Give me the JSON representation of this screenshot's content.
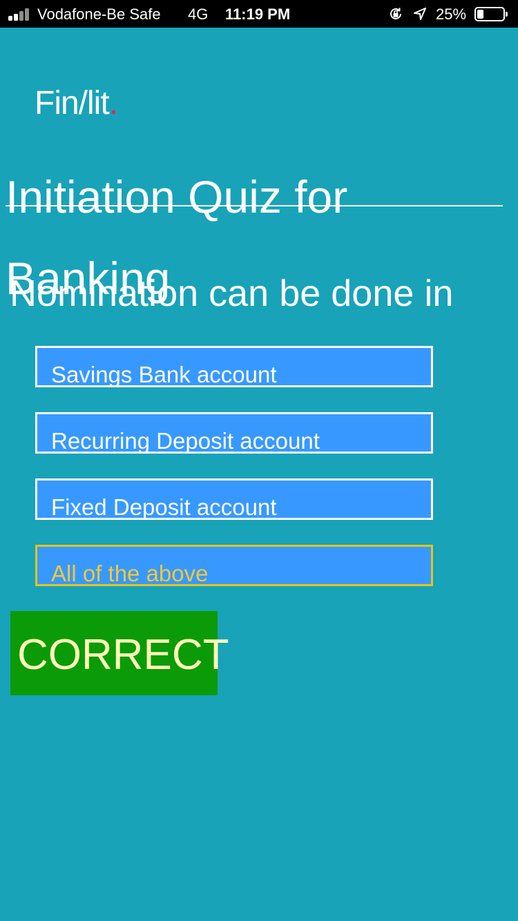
{
  "status_bar": {
    "carrier": "Vodafone-Be Safe",
    "network": "4G",
    "time": "11:19 PM",
    "battery_percent": "25%",
    "battery_level": 0.25,
    "icons": [
      "signal-icon",
      "orientation-lock-icon",
      "location-arrow-icon",
      "battery-icon"
    ]
  },
  "brand": {
    "name": "Fin/lit",
    "dot": ".",
    "dot_color": "#e0245e"
  },
  "quiz": {
    "title_line1": "Initiation Quiz for",
    "title_line2": "Banking",
    "question": "Nomination can be done in",
    "options": [
      {
        "label": "Savings Bank account",
        "selected": false
      },
      {
        "label": "Recurring Deposit account",
        "selected": false
      },
      {
        "label": "Fixed Deposit account",
        "selected": false
      },
      {
        "label": "All of the above",
        "selected": true
      }
    ],
    "result": "CORRECT"
  },
  "colors": {
    "background": "#18a3b8",
    "option_fill": "#3799ff",
    "selected_border": "#e6c419",
    "result_fill": "#0c9b08",
    "result_text": "#ffffb8"
  }
}
